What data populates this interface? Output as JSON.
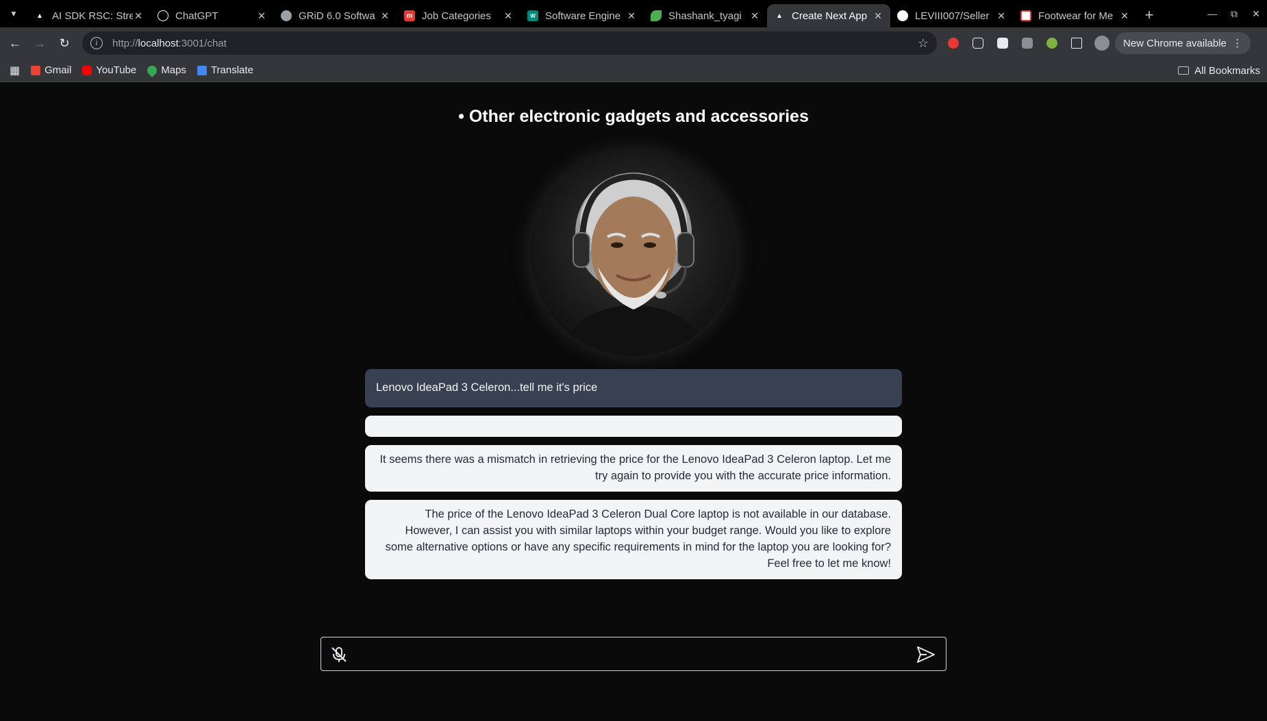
{
  "browser": {
    "tabs": [
      {
        "title": "AI SDK RSC: Stre",
        "favicon_color": "#ffffff",
        "active": false
      },
      {
        "title": "ChatGPT",
        "favicon_color": "#ffffff",
        "active": false
      },
      {
        "title": "GRiD 6.0 Softwa",
        "favicon_color": "#9aa0a6",
        "active": false
      },
      {
        "title": "Job Categories",
        "favicon_color": "#e53935",
        "active": false
      },
      {
        "title": "Software Engine",
        "favicon_color": "#00897b",
        "active": false
      },
      {
        "title": "Shashank_tyagi",
        "favicon_color": "#4caf50",
        "active": false
      },
      {
        "title": "Create Next App",
        "favicon_color": "#ffffff",
        "active": true
      },
      {
        "title": "LEVIII007/Seller",
        "favicon_color": "#ffffff",
        "active": false
      },
      {
        "title": "Footwear for Me",
        "favicon_color": "#e53935",
        "active": false
      }
    ],
    "url_prefix": "http://",
    "url_host": "localhost",
    "url_rest": ":3001/chat",
    "update_button": "New Chrome available",
    "bookmarks": [
      {
        "label": "Gmail",
        "color": "#ea4335"
      },
      {
        "label": "YouTube",
        "color": "#ff0000"
      },
      {
        "label": "Maps",
        "color": "#34a853"
      },
      {
        "label": "Translate",
        "color": "#4285f4"
      }
    ],
    "all_bookmarks": "All Bookmarks"
  },
  "page": {
    "heading": "• Other electronic gadgets and accessories",
    "messages": [
      {
        "role": "user",
        "text": "Lenovo IdeaPad 3 Celeron...tell me it's price"
      },
      {
        "role": "assistant",
        "text": ""
      },
      {
        "role": "assistant",
        "text": "It seems there was a mismatch in retrieving the price for the Lenovo IdeaPad 3 Celeron laptop. Let me try again to provide you with the accurate price information."
      },
      {
        "role": "assistant",
        "text": "The price of the Lenovo IdeaPad 3 Celeron Dual Core laptop is not available in our database. However, I can assist you with similar laptops within your budget range. Would you like to explore some alternative options or have any specific requirements in mind for the laptop you are looking for? Feel free to let me know!"
      }
    ],
    "input": {
      "value": "",
      "placeholder": ""
    }
  }
}
